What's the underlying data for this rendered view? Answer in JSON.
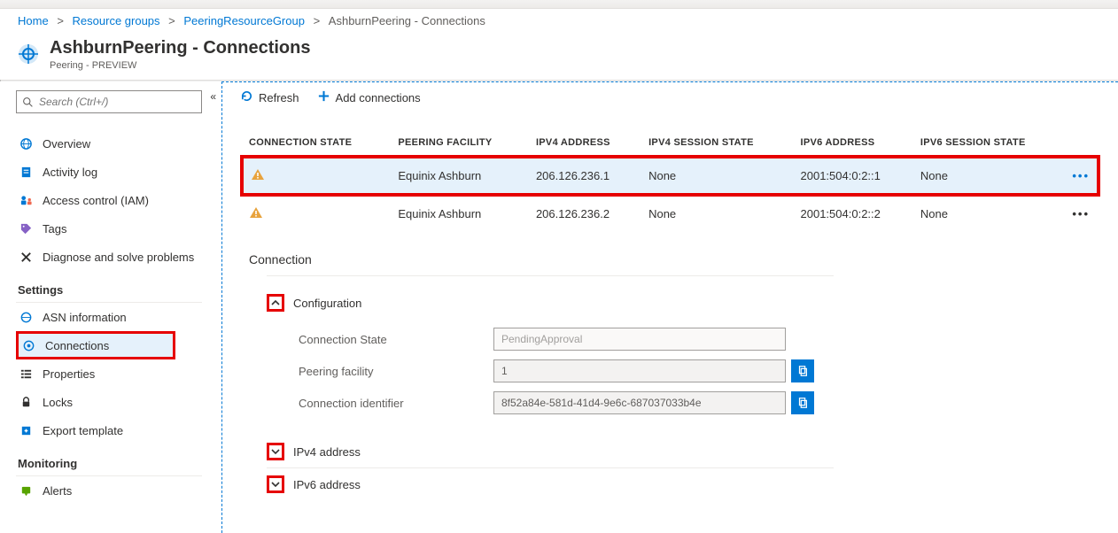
{
  "breadcrumb": {
    "items": [
      {
        "label": "Home"
      },
      {
        "label": "Resource groups"
      },
      {
        "label": "PeeringResourceGroup"
      }
    ],
    "current": "AshburnPeering - Connections"
  },
  "header": {
    "title": "AshburnPeering - Connections",
    "subtitle": "Peering - PREVIEW"
  },
  "sidebar": {
    "search_placeholder": "Search (Ctrl+/)",
    "items_top": [
      {
        "label": "Overview"
      },
      {
        "label": "Activity log"
      },
      {
        "label": "Access control (IAM)"
      },
      {
        "label": "Tags"
      },
      {
        "label": "Diagnose and solve problems"
      }
    ],
    "group_settings": "Settings",
    "items_settings": [
      {
        "label": "ASN information"
      },
      {
        "label": "Connections"
      },
      {
        "label": "Properties"
      },
      {
        "label": "Locks"
      },
      {
        "label": "Export template"
      }
    ],
    "group_monitoring": "Monitoring",
    "items_monitoring": [
      {
        "label": "Alerts"
      }
    ]
  },
  "toolbar": {
    "refresh": "Refresh",
    "add": "Add connections"
  },
  "table": {
    "headers": {
      "state": "Connection State",
      "facility": "Peering Facility",
      "ipv4": "IPv4 Address",
      "ipv4ss": "IPv4 Session State",
      "ipv6": "IPv6 Address",
      "ipv6ss": "IPv6 Session State"
    },
    "rows": [
      {
        "facility": "Equinix Ashburn",
        "ipv4": "206.126.236.1",
        "ipv4ss": "None",
        "ipv6": "2001:504:0:2::1",
        "ipv6ss": "None"
      },
      {
        "facility": "Equinix Ashburn",
        "ipv4": "206.126.236.2",
        "ipv4ss": "None",
        "ipv6": "2001:504:0:2::2",
        "ipv6ss": "None"
      }
    ]
  },
  "detail": {
    "section": "Connection",
    "config": {
      "title": "Configuration",
      "state_label": "Connection State",
      "state_value": "PendingApproval",
      "facility_label": "Peering facility",
      "facility_value": "1",
      "id_label": "Connection identifier",
      "id_value": "8f52a84e-581d-41d4-9e6c-687037033b4e"
    },
    "ipv4_section": "IPv4 address",
    "ipv6_section": "IPv6 address"
  }
}
